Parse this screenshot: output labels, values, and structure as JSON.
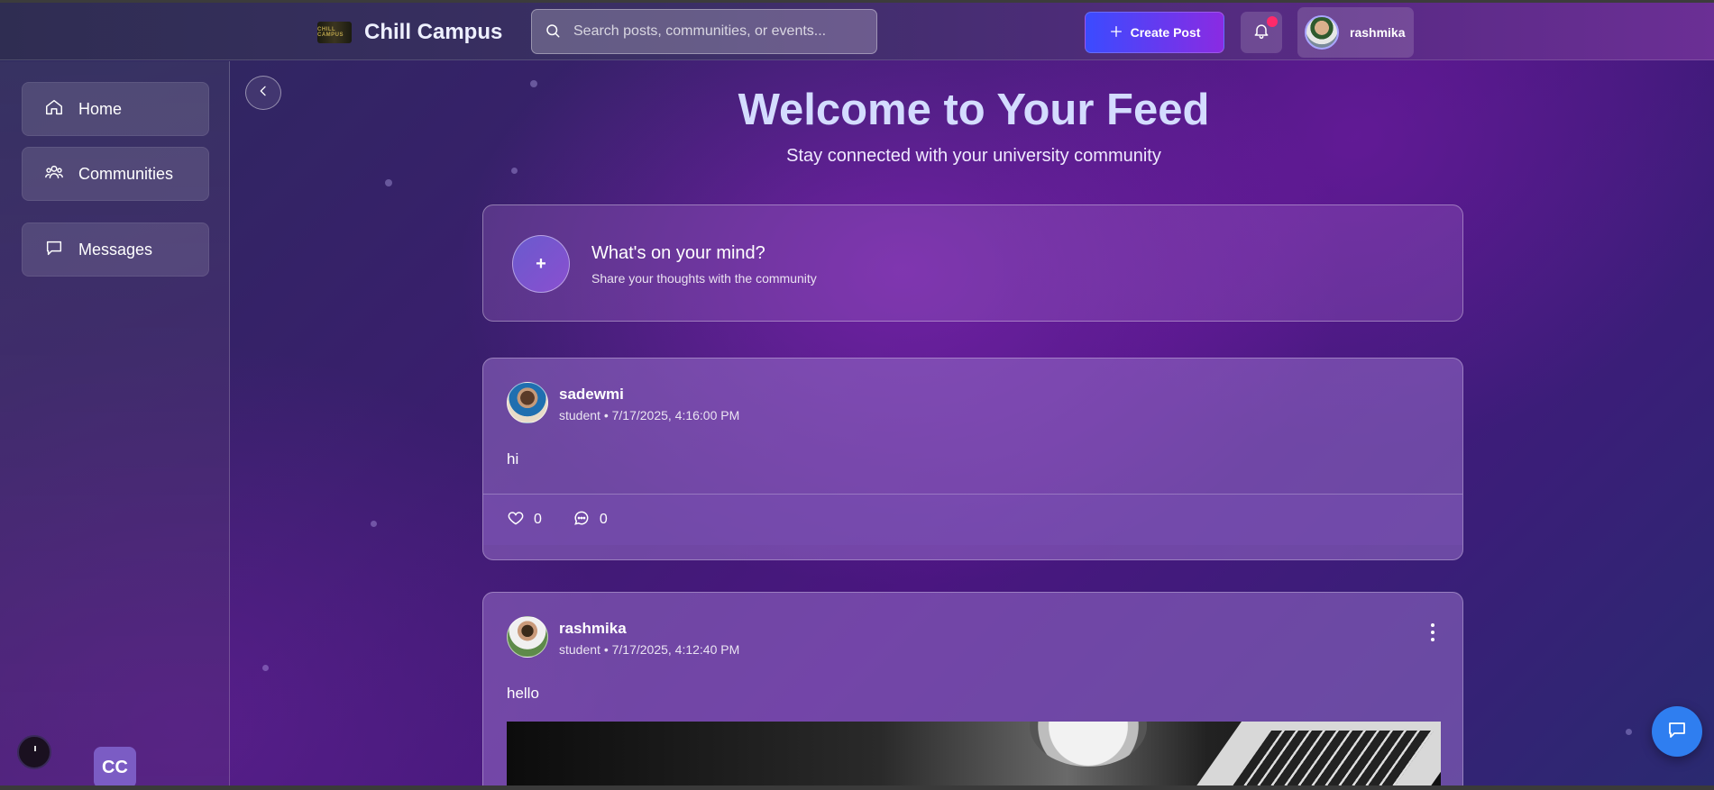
{
  "header": {
    "app_title": "Chill Campus",
    "logo_text": "CHILL CAMPUS",
    "search_placeholder": "Search posts, communities, or events...",
    "create_post_label": "Create Post",
    "user_name": "rashmika"
  },
  "sidebar": {
    "items": [
      {
        "label": "Home",
        "icon": "home-icon"
      },
      {
        "label": "Communities",
        "icon": "users-icon"
      },
      {
        "label": "Messages",
        "icon": "message-icon"
      }
    ],
    "badge_text": "CC"
  },
  "feed": {
    "title": "Welcome to Your Feed",
    "subtitle": "Stay connected with your university community",
    "composer_plus": "+",
    "composer_title": "What's on your mind?",
    "composer_subtitle": "Share your thoughts with the community"
  },
  "posts": [
    {
      "author": "sadewmi",
      "meta": "student • 7/17/2025, 4:16:00 PM",
      "body": "hi",
      "likes": "0",
      "comments": "0"
    },
    {
      "author": "rashmika",
      "meta": "student • 7/17/2025, 4:12:40 PM",
      "body": "hello"
    }
  ],
  "colors": {
    "accent_gradient_start": "#3b4bff",
    "accent_gradient_end": "#8a2be2",
    "notification_dot": "#ff2a6a",
    "chat_button": "#2f7ef0"
  }
}
